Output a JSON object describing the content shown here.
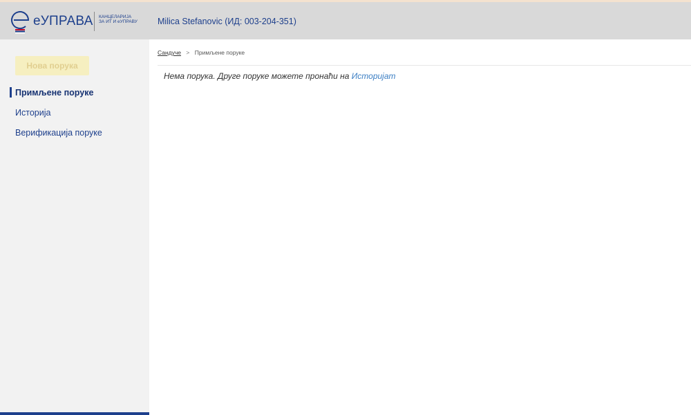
{
  "header": {
    "logo_name": "еУПРАВА",
    "logo_subtitle": "КАНЦЕЛАРИЈА\nЗА ИТ И еУПРАВУ",
    "user": "Milica Stefanovic (ИД: 003-204-351)"
  },
  "sidebar": {
    "new_button": "Нова порука",
    "items": [
      {
        "label": "Примљене поруке",
        "active": true
      },
      {
        "label": "Историја"
      },
      {
        "label": "Верификација поруке"
      }
    ]
  },
  "breadcrumb": {
    "root": "Сандуче",
    "separator": ">",
    "current": "Примљене поруке"
  },
  "main": {
    "empty_message": "Нема порука. Друге поруке можете пронаћи на",
    "history_link": "Историјат"
  },
  "colors": {
    "brand_blue": "#1d3f8c",
    "header_bg": "#d9d9d9",
    "sidebar_bg": "#f2f2f2",
    "new_button_bg": "#f6efc0",
    "link": "#3c7fc4"
  },
  "icons": {
    "logo": "euprava-e-logo-icon"
  }
}
